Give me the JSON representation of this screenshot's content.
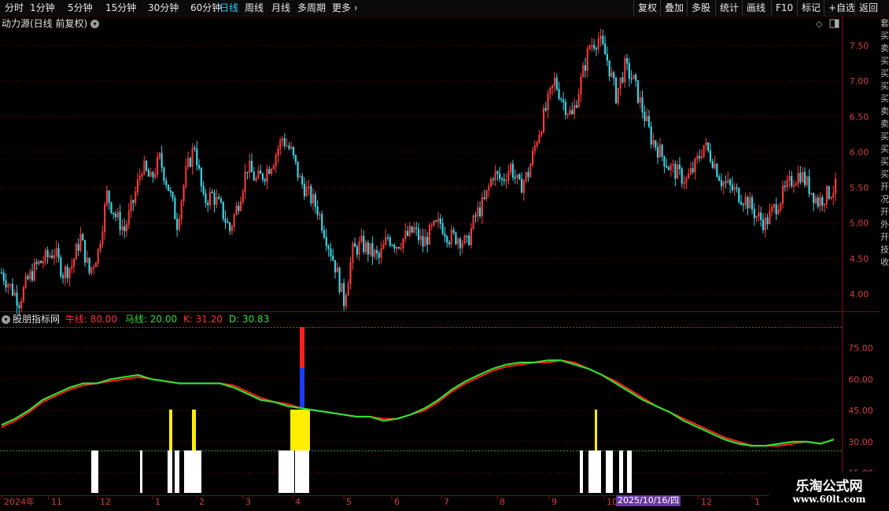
{
  "toolbar": {
    "periods": [
      "分时",
      "1分钟",
      "5分钟",
      "15分钟",
      "30分钟",
      "60分钟",
      "日线",
      "周线",
      "月线",
      "多周期",
      "更多"
    ],
    "active_period": "日线",
    "right_buttons": [
      "复权",
      "叠加",
      "多股",
      "统计",
      "画线",
      "F10",
      "标记",
      "+自选",
      "返回"
    ],
    "more_chevron": "chevron-right-icon"
  },
  "main_chart": {
    "title": "动力源(日线 前复权)",
    "y_ticks": [
      "7.50",
      "7.00",
      "6.50",
      "6.00",
      "5.50",
      "5.00",
      "4.50",
      "4.00"
    ]
  },
  "indicator": {
    "name": "股朋指标网",
    "bull_label": "牛线: 80.00",
    "horse_label": "马线: 20.00",
    "k_label": "K: 31.20",
    "d_label": "D: 30.83",
    "y_ticks": [
      "75.00",
      "60.00",
      "45.00",
      "30.00",
      "15.00"
    ]
  },
  "x_axis": {
    "labels": [
      "2024年",
      "11",
      "12",
      "1",
      "2",
      "3",
      "4",
      "5",
      "6",
      "7",
      "8",
      "9",
      "10",
      "11",
      "12",
      "1"
    ],
    "highlight_date": "2025/10/16/四"
  },
  "watermark": {
    "line1": "乐淘公式网",
    "line2": "www.60lt.com"
  },
  "right_strip": "套买卖买买买买卖卖买买买买开况开外开技收",
  "colors": {
    "up": "#ff4040",
    "down": "#40d0e0",
    "k_line": "#33dd33",
    "d_line": "#ff2020",
    "active": "#33ccff",
    "signal_yellow": "#ffee00"
  },
  "chart_data": [
    {
      "type": "candlestick",
      "title": "动力源(日线 前复权)",
      "ylim": [
        3.8,
        7.7
      ],
      "x": [
        "2024年",
        "11",
        "12",
        "1",
        "2",
        "3",
        "4",
        "5",
        "6",
        "7",
        "8",
        "9",
        "10",
        "11",
        "12",
        "1"
      ],
      "series": [
        {
          "values": [
            4.3,
            4.1,
            3.9,
            4.2,
            4.4,
            4.5,
            4.6,
            4.3,
            4.4,
            4.8,
            4.3,
            4.6,
            5.4,
            5.1,
            4.9,
            5.3,
            5.8,
            5.6,
            5.9,
            5.5,
            5.0,
            5.7,
            6.1,
            5.3,
            5.4,
            5.2,
            4.9,
            5.3,
            5.8,
            5.6,
            5.7,
            5.9,
            6.2,
            6.0,
            5.6,
            5.4,
            5.2,
            4.8,
            4.4,
            3.9,
            4.6,
            4.7,
            4.6,
            4.5,
            4.8,
            4.7,
            4.8,
            4.9,
            4.7,
            4.9,
            5.0,
            4.8,
            4.8,
            4.7,
            5.1,
            5.3,
            5.7,
            5.6,
            5.8,
            5.5,
            5.7,
            6.2,
            6.6,
            7.0,
            6.7,
            6.5,
            7.0,
            7.5,
            7.6,
            7.3,
            6.8,
            7.2,
            7.0,
            6.6,
            6.2,
            6.0,
            5.8,
            5.7,
            5.6,
            5.8,
            6.1,
            5.9,
            5.6,
            5.5,
            5.4,
            5.3,
            5.1,
            5.0,
            5.2,
            5.4,
            5.6,
            5.7,
            5.5,
            5.3,
            5.4,
            5.5
          ]
        }
      ]
    },
    {
      "type": "line",
      "ylim": [
        5,
        85
      ],
      "series": [
        {
          "name": "K",
          "values": [
            38,
            41,
            45,
            50,
            53,
            56,
            58,
            58,
            60,
            61,
            62,
            60,
            59,
            58,
            58,
            58,
            58,
            56,
            53,
            50,
            49,
            47,
            46,
            45,
            44,
            43,
            42,
            42,
            40,
            41,
            43,
            46,
            50,
            55,
            59,
            62,
            65,
            67,
            68,
            68,
            69,
            69,
            67,
            65,
            62,
            58,
            54,
            50,
            47,
            44,
            40,
            37,
            34,
            31,
            29,
            28,
            28,
            29,
            30,
            30,
            29,
            31
          ]
        },
        {
          "name": "D",
          "values": [
            37,
            40,
            44,
            49,
            52,
            55,
            57,
            58,
            59,
            60,
            61,
            60,
            59,
            58,
            58,
            58,
            58,
            57,
            54,
            51,
            49,
            48,
            46,
            45,
            44,
            43,
            42,
            42,
            41,
            41,
            43,
            45,
            49,
            54,
            58,
            61,
            64,
            66,
            67,
            68,
            68,
            69,
            68,
            65,
            62,
            59,
            55,
            51,
            47,
            44,
            41,
            38,
            35,
            32,
            30,
            28,
            28,
            28,
            29,
            30,
            29,
            31
          ]
        }
      ]
    }
  ]
}
